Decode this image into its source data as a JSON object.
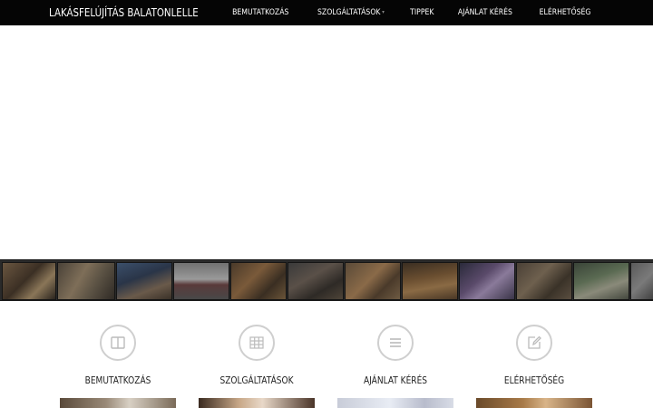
{
  "navbar": {
    "brand": "LAKÁSFELÚJÍTÁS BALATONLELLE",
    "items": [
      {
        "label": "BEMUTATKOZÁS"
      },
      {
        "label": "SZOLGÁLTATÁSOK",
        "has_dropdown": true
      },
      {
        "label": "TIPPEK"
      },
      {
        "label": "AJÁNLAT KÉRÉS"
      },
      {
        "label": "ELÉRHETŐSÉG"
      }
    ]
  },
  "features": [
    {
      "title": "BEMUTATKOZÁS",
      "icon": "book-icon"
    },
    {
      "title": "SZOLGÁLTATÁSOK",
      "icon": "table-icon"
    },
    {
      "title": "AJÁNLAT KÉRÉS",
      "icon": "list-icon"
    },
    {
      "title": "ELÉRHETŐSÉG",
      "icon": "edit-icon"
    }
  ],
  "colors": {
    "navbar_bg": "#050505",
    "navbar_text": "#ffffff",
    "filmstrip_bg": "#2a2a2a",
    "icon_circle": "#cfcfcf",
    "icon_stroke": "#bbbbbb"
  }
}
